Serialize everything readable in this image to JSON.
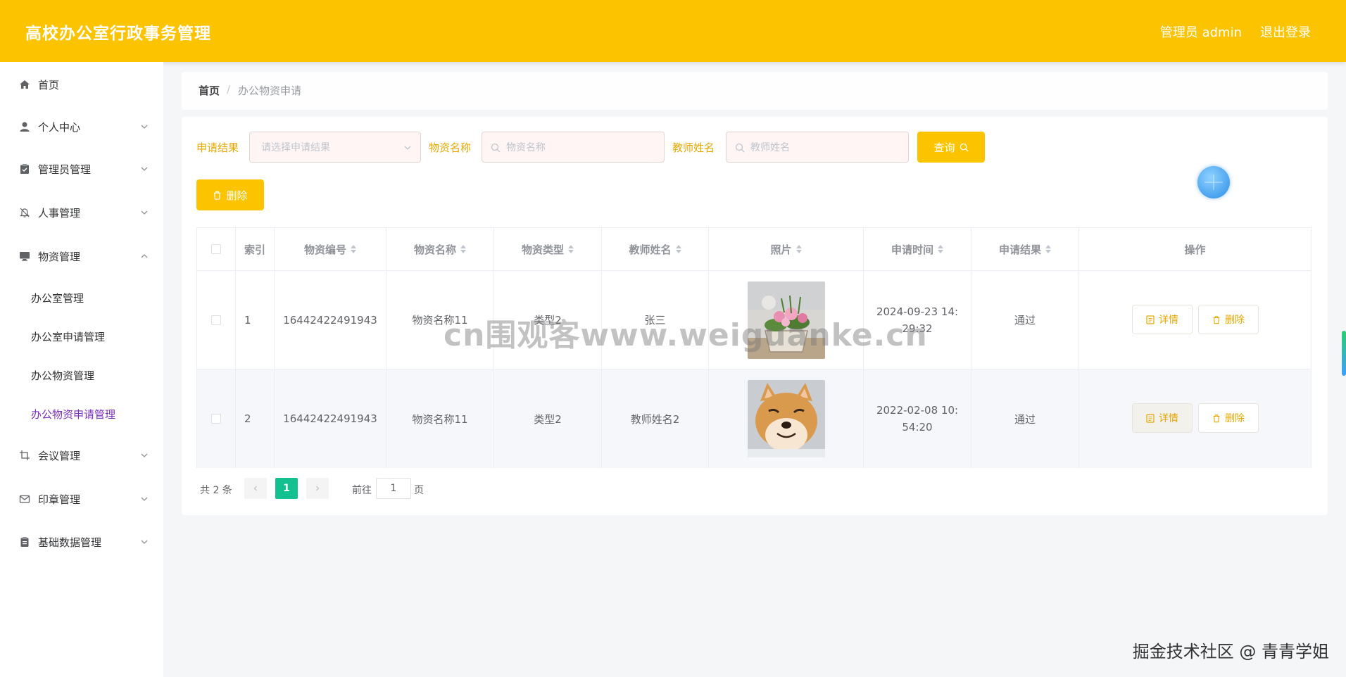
{
  "header": {
    "brand": "高校办公室行政事务管理",
    "user": "管理员 admin",
    "logout": "退出登录"
  },
  "sidebar": {
    "items": [
      {
        "label": "首页",
        "icon": "home-icon"
      },
      {
        "label": "个人中心",
        "icon": "user-icon"
      },
      {
        "label": "管理员管理",
        "icon": "clipboard-check-icon"
      },
      {
        "label": "人事管理",
        "icon": "bell-off-icon"
      },
      {
        "label": "物资管理",
        "icon": "monitor-icon"
      },
      {
        "label": "会议管理",
        "icon": "crop-icon"
      },
      {
        "label": "印章管理",
        "icon": "mail-icon"
      },
      {
        "label": "基础数据管理",
        "icon": "clipboard-icon"
      }
    ],
    "subitems": [
      "办公室管理",
      "办公室申请管理",
      "办公物资管理",
      "办公物资申请管理"
    ]
  },
  "breadcrumb": {
    "home": "首页",
    "separator": "/",
    "current": "办公物资申请"
  },
  "filters": {
    "result_label": "申请结果",
    "result_placeholder": "请选择申请结果",
    "name_label": "物资名称",
    "name_placeholder": "物资名称",
    "teacher_label": "教师姓名",
    "teacher_placeholder": "教师姓名",
    "query_button": "查询"
  },
  "toolbar": {
    "delete_button": "删除"
  },
  "table": {
    "headers": [
      "索引",
      "物资编号",
      "物资名称",
      "物资类型",
      "教师姓名",
      "照片",
      "申请时间",
      "申请结果",
      "操作"
    ],
    "rows": [
      {
        "index": "1",
        "code": "16442422491943",
        "name": "物资名称11",
        "type": "类型2",
        "teacher": "张三",
        "photo": "flower-basket-photo",
        "time": "2024-09-23 14:29:32",
        "result": "通过"
      },
      {
        "index": "2",
        "code": "16442422491943",
        "name": "物资名称11",
        "type": "类型2",
        "teacher": "教师姓名2",
        "photo": "shiba-dog-photo",
        "time": "2022-02-08 10:54:20",
        "result": "通过"
      }
    ],
    "detail_button": "详情",
    "row_delete_button": "删除"
  },
  "pagination": {
    "total": "共 2 条",
    "current_page": "1",
    "goto_label": "前往",
    "goto_value": "1",
    "page_suffix": "页"
  },
  "watermarks": {
    "overlay": "cn围观客www.weiguanke.cn",
    "footer": "掘金技术社区 @ 青青学姐"
  },
  "colors": {
    "accent": "#fcc300",
    "active_purple": "#7b2fbd",
    "pager_active": "#13c08f"
  }
}
